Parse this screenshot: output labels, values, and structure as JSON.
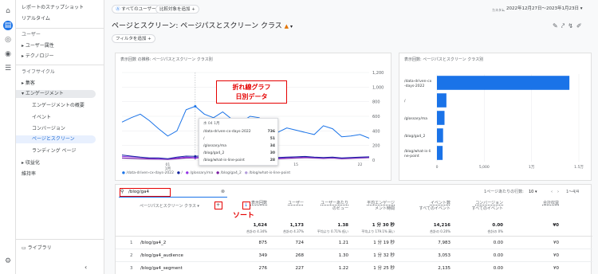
{
  "colors": {
    "accent": "#1a73e8",
    "annotation": "#e50000"
  },
  "rail": {
    "icons": [
      "home-icon",
      "reports-icon",
      "explore-icon",
      "advertising-icon",
      "configure-icon",
      "settings-icon"
    ]
  },
  "nav": {
    "snapshot": "レポートのスナップショット",
    "realtime": "リアルタイム",
    "user_section": "ユーザー",
    "user_attr": "ユーザー属性",
    "tech": "テクノロジー",
    "lifecycle": "ライフサイクル",
    "acquisition": "集客",
    "engagement": "エンゲージメント",
    "engagement_overview": "エンゲージメントの概要",
    "events": "イベント",
    "conversions": "コンバージョン",
    "pages_screens": "ページとスクリーン",
    "landing": "ランディング ページ",
    "monetization": "収益化",
    "retention": "維持率",
    "library": "ライブラリ"
  },
  "header": {
    "all_users": "すべてのユーザー",
    "add_compare": "比較対象を追加",
    "custom_label": "カスタム",
    "date_range": "2022年12月27日〜2023年1月23日",
    "title": "ページとスクリーン: ページパスとスクリーン クラス",
    "add_filter": "フィルタを追加"
  },
  "line_chart": {
    "title": "表示回数 の推移: ページパスとスクリーン クラス別",
    "annotation_line1": "折れ線グラフ",
    "annotation_line2": "日別データ",
    "tooltip": {
      "date": "水 04 1月",
      "rows": [
        {
          "label": "/data-driven-cx-days-2022",
          "value": "736"
        },
        {
          "label": "/",
          "value": "51"
        },
        {
          "label": "/glossary/ma",
          "value": "34"
        },
        {
          "label": "/blog/ga4_2",
          "value": "30"
        },
        {
          "label": "/blog/what-is-line-point",
          "value": "28"
        }
      ]
    },
    "legend": [
      "/data-driven-cx-days-2022",
      "/",
      "/glossary/ma",
      "/blog/ga4_2",
      "/blog/what-is-line-point"
    ]
  },
  "bar_chart": {
    "title": "表示回数: ページパスとスクリーン クラス別"
  },
  "chart_data": [
    {
      "type": "line",
      "title": "表示回数 の推移: ページパスとスクリーン クラス別",
      "x": [
        "12/27",
        "12/28",
        "12/29",
        "12/30",
        "12/31",
        "1/1",
        "1/2",
        "1/3",
        "1/4",
        "1/5",
        "1/6",
        "1/7",
        "1/8",
        "1/9",
        "1/10",
        "1/11",
        "1/12",
        "1/13",
        "1/14",
        "1/15",
        "1/16",
        "1/17",
        "1/18",
        "1/19",
        "1/20",
        "1/21",
        "1/22",
        "1/23"
      ],
      "x_ticks": [
        "01 1月",
        "08",
        "15",
        "22"
      ],
      "y_ticks": [
        0,
        200,
        400,
        600,
        800,
        1000,
        1200
      ],
      "ylim": [
        0,
        1200
      ],
      "series": [
        {
          "name": "/data-driven-cx-days-2022",
          "color": "#1a73e8",
          "values": [
            520,
            580,
            630,
            540,
            430,
            330,
            400,
            690,
            736,
            630,
            580,
            660,
            560,
            520,
            600,
            580,
            440,
            380,
            440,
            410,
            380,
            350,
            470,
            430,
            320,
            330,
            350,
            300
          ]
        },
        {
          "name": "/",
          "color": "#12239e",
          "values": [
            70,
            55,
            40,
            30,
            30,
            20,
            40,
            55,
            51,
            60,
            50,
            40,
            35,
            45,
            50,
            55,
            40,
            35,
            40,
            45,
            50,
            40,
            35,
            40,
            30,
            35,
            40,
            45
          ]
        },
        {
          "name": "/glossary/ma",
          "color": "#9334e6",
          "values": [
            50,
            45,
            35,
            25,
            20,
            15,
            30,
            40,
            34,
            45,
            40,
            35,
            30,
            35,
            45,
            40,
            30,
            25,
            35,
            40,
            45,
            35,
            30,
            35,
            25,
            30,
            35,
            40
          ]
        },
        {
          "name": "/blog/ga4_2",
          "color": "#7b1fa2",
          "values": [
            30,
            25,
            20,
            15,
            15,
            10,
            20,
            30,
            30,
            35,
            30,
            25,
            25,
            30,
            35,
            30,
            25,
            20,
            25,
            30,
            35,
            30,
            25,
            30,
            20,
            25,
            30,
            35
          ]
        },
        {
          "name": "/blog/what-is-line-point",
          "color": "#b39ddb",
          "values": [
            25,
            20,
            15,
            12,
            10,
            8,
            15,
            25,
            28,
            30,
            25,
            20,
            20,
            25,
            30,
            25,
            20,
            15,
            20,
            25,
            30,
            25,
            20,
            25,
            15,
            20,
            25,
            30
          ]
        }
      ]
    },
    {
      "type": "bar",
      "title": "表示回数: ページパスとスクリーン クラス別",
      "categories": [
        "/data-driven-cx-days-2022",
        "/",
        "/glossary/ma",
        "/blog/ga4_2",
        "/blog/what-is-line-point"
      ],
      "category_labels": [
        [
          "/data-driven-cx",
          "-days-2022"
        ],
        [
          "/"
        ],
        [
          "/glossary/ma"
        ],
        [
          "/blog/ga4_2"
        ],
        [
          "/blog/what-is-li",
          "ne-point"
        ]
      ],
      "values": [
        14000,
        1000,
        800,
        650,
        600
      ],
      "x_ticks": [
        "0",
        "5,000",
        "1万",
        "1.5万"
      ],
      "xlim": [
        0,
        15000
      ]
    }
  ],
  "table": {
    "search_value": "/blog/ga4",
    "rows_per_page_label": "1ページあたりの行数:",
    "rows_per_page": "10",
    "pagination": "1〜4/4",
    "dim_header": "ページパスとスクリーン クラス",
    "sort_annotation": "ソート",
    "columns": [
      {
        "h1": "表示回数",
        "h2": ""
      },
      {
        "h1": "ユーザー",
        "h2": ""
      },
      {
        "h1": "ユーザーあたり",
        "h2": "のビュー"
      },
      {
        "h1": "平均エンゲージ",
        "h2": "メント時間"
      },
      {
        "h1": "イベント数",
        "h2": "すべてのイベント"
      },
      {
        "h1": "コンバージョン",
        "h2": "すべてのイベント"
      },
      {
        "h1": "合計収益",
        "h2": ""
      }
    ],
    "totals": [
      {
        "v": "1,624",
        "s": "合計の 4.34%"
      },
      {
        "v": "1,173",
        "s": "合計の 4.37%"
      },
      {
        "v": "1.38",
        "s": "平均より 0.71% 低い"
      },
      {
        "v": "1 分 30 秒",
        "s": "平均より 179.1% 高い"
      },
      {
        "v": "14,216",
        "s": "合計の 0.20%"
      },
      {
        "v": "0.00",
        "s": "合計の 0%"
      },
      {
        "v": "¥0",
        "s": ""
      }
    ],
    "rows": [
      {
        "idx": "1",
        "path": "/blog/ga4_2",
        "cells": [
          "875",
          "724",
          "1.21",
          "1 分 19 秒",
          "7,983",
          "0.00",
          "¥0"
        ]
      },
      {
        "idx": "2",
        "path": "/blog/ga4_audience",
        "cells": [
          "349",
          "268",
          "1.30",
          "1 分 32 秒",
          "3,053",
          "0.00",
          "¥0"
        ]
      },
      {
        "idx": "3",
        "path": "/blog/ga4_segment",
        "cells": [
          "276",
          "227",
          "1.22",
          "1 分 25 秒",
          "2,135",
          "0.00",
          "¥0"
        ]
      }
    ]
  }
}
